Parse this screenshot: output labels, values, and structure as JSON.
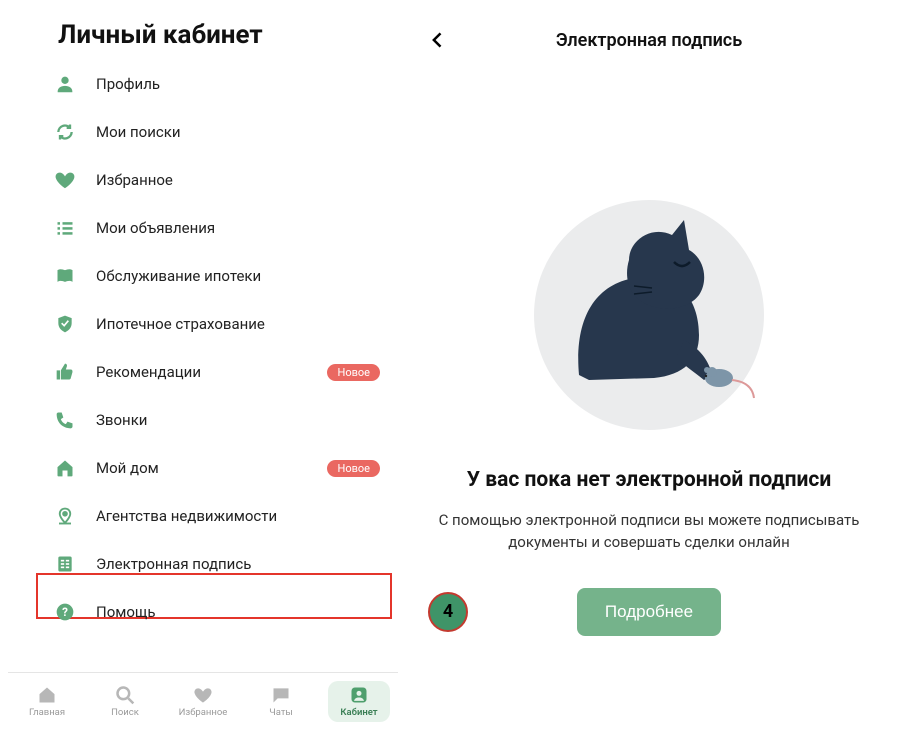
{
  "left": {
    "title": "Личный кабинет",
    "menu": [
      {
        "label": "Профиль"
      },
      {
        "label": "Мои поиски"
      },
      {
        "label": "Избранное"
      },
      {
        "label": "Мои объявления"
      },
      {
        "label": "Обслуживание ипотеки"
      },
      {
        "label": "Ипотечное страхование"
      },
      {
        "label": "Рекомендации",
        "badge": "Новое"
      },
      {
        "label": "Звонки"
      },
      {
        "label": "Мой дом",
        "badge": "Новое"
      },
      {
        "label": "Агентства недвижимости"
      },
      {
        "label": "Электронная подпись"
      },
      {
        "label": "Помощь"
      }
    ],
    "bottom": [
      {
        "label": "Главная"
      },
      {
        "label": "Поиск"
      },
      {
        "label": "Избранное"
      },
      {
        "label": "Чаты"
      },
      {
        "label": "Кабинет"
      }
    ]
  },
  "right": {
    "title": "Электронная подпись",
    "empty_heading": "У вас пока нет электронной подписи",
    "empty_desc": "С помощью электронной подписи вы можете подписывать документы и совершать сделки онлайн",
    "cta": "Подробнее",
    "step": "4"
  }
}
